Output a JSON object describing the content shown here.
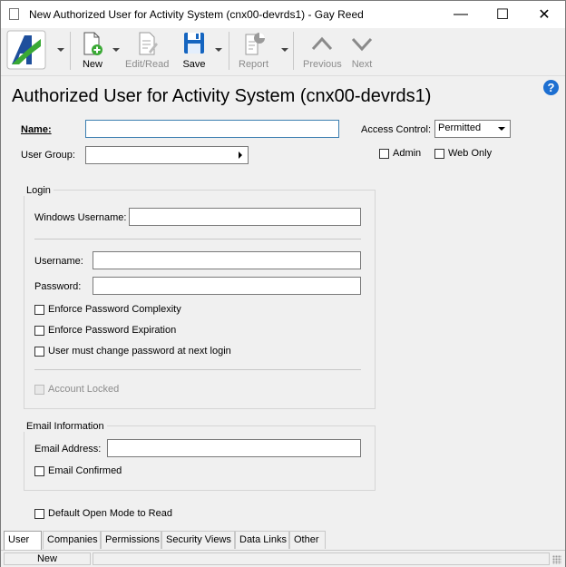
{
  "window": {
    "title": "New Authorized User for Activity System (cnx00-devrds1) - Gay Reed",
    "minimize": "—",
    "maximize": "☐",
    "close": "✕"
  },
  "toolbar": {
    "new_label": "New",
    "editread_label": "Edit/Read",
    "save_label": "Save",
    "report_label": "Report",
    "previous_label": "Previous",
    "next_label": "Next"
  },
  "header": {
    "title": "Authorized User for Activity System (cnx00-devrds1)",
    "help": "?"
  },
  "form": {
    "name_label": "Name:",
    "name_value": "",
    "user_group_label": "User Group:",
    "user_group_value": "",
    "access_control_label": "Access Control:",
    "access_control_value": "Permitted",
    "admin_label": "Admin",
    "web_only_label": "Web Only"
  },
  "login": {
    "title": "Login",
    "windows_username_label": "Windows Username:",
    "username_label": "Username:",
    "password_label": "Password:",
    "enforce_complexity": "Enforce Password Complexity",
    "enforce_expiration": "Enforce Password Expiration",
    "must_change": "User must change password at next login",
    "account_locked": "Account Locked"
  },
  "email": {
    "title": "Email Information",
    "address_label": "Email Address:",
    "confirmed": "Email Confirmed"
  },
  "default_open_mode": "Default Open Mode to Read",
  "tabs": [
    "User",
    "Companies",
    "Permissions",
    "Security Views",
    "Data Links",
    "Other"
  ],
  "status": {
    "mode": "New"
  },
  "colors": {
    "accent": "#1d6fd1",
    "logo_green": "#3aa935",
    "logo_blue": "#1e4f9c"
  }
}
